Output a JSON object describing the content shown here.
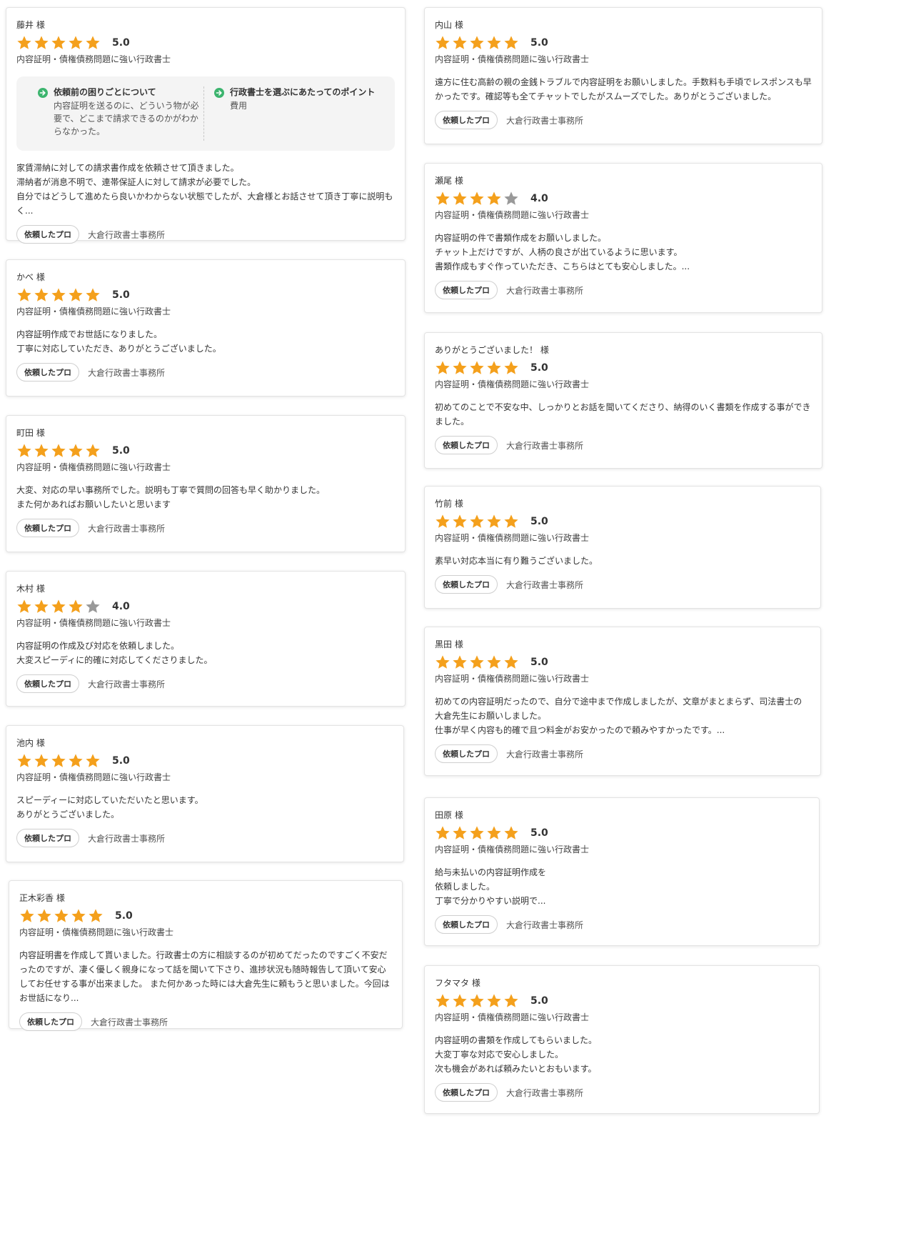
{
  "colors": {
    "star_filled": "#f4a01c",
    "star_empty": "#999999",
    "arrow": "#3cb46e"
  },
  "icons": {
    "star": "star-icon",
    "arrow": "arrow-right-circle-icon"
  },
  "common": {
    "specialty": "内容証明・債権債務問題に強い行政書士",
    "pro_button": "依頼したプロ",
    "office": "大倉行政書士事務所"
  },
  "reviews": [
    {
      "name": "藤井 様",
      "rating": "5.0",
      "stars": 5,
      "detail": {
        "q1_title": "依頼前の困りごとについて",
        "q1_text": "内容証明を送るのに、どういう物が必要で、どこまで請求できるのかがわからなかった。",
        "q2_title": "行政書士を選ぶにあたってのポイント",
        "q2_text": "費用"
      },
      "text": "家賃滞納に対しての請求書作成を依頼させて頂きました。\n滞納者が消息不明で、連帯保証人に対して請求が必要でした。\n自分ではどうして進めたら良いかわからない状態でしたが、大倉様とお話させて頂き丁寧に説明もく..."
    },
    {
      "name": "かべ 様",
      "rating": "5.0",
      "stars": 5,
      "text": "内容証明作成でお世話になりました。\n丁寧に対応していただき、ありがとうございました。"
    },
    {
      "name": "町田 様",
      "rating": "5.0",
      "stars": 5,
      "text": "大変、対応の早い事務所でした。説明も丁寧で質問の回答も早く助かりました。\nまた何かあればお願いしたいと思います"
    },
    {
      "name": "木村 様",
      "rating": "4.0",
      "stars": 4,
      "text": "内容証明の作成及び対応を依頼しました。\n大変スピーディに的確に対応してくださりました。"
    },
    {
      "name": "池内 様",
      "rating": "5.0",
      "stars": 5,
      "text": "スピーディーに対応していただいたと思います。\nありがとうございました。"
    },
    {
      "name": "正木彩香 様",
      "rating": "5.0",
      "stars": 5,
      "text": "内容証明書を作成して貰いました。行政書士の方に相談するのが初めてだったのですごく不安だったのですが、凄く優しく親身になって話を聞いて下さり、進捗状況も随時報告して頂いて安心してお任せする事が出来ました。 また何かあった時には大倉先生に頼もうと思いました。今回はお世話になり..."
    },
    {
      "name": "内山 様",
      "rating": "5.0",
      "stars": 5,
      "text": "遠方に住む高齢の親の金銭トラブルで内容証明をお願いしました。手数料も手頃でレスポンスも早かったです。確認等も全てチャットでしたがスムーズでした。ありがとうございました。"
    },
    {
      "name": "瀬尾 様",
      "rating": "4.0",
      "stars": 4,
      "text": "内容証明の件で書類作成をお願いしました。\nチャット上だけですが、人柄の良さが出ているように思います。\n書類作成もすぐ作っていただき、こちらはとても安心しました。..."
    },
    {
      "name": "ありがとうございました！ 様",
      "rating": "5.0",
      "stars": 5,
      "text": "初めてのことで不安な中、しっかりとお話を聞いてくださり、納得のいく書類を作成する事ができました。"
    },
    {
      "name": "竹前 様",
      "rating": "5.0",
      "stars": 5,
      "text": "素早い対応本当に有り難うございました。"
    },
    {
      "name": "黒田 様",
      "rating": "5.0",
      "stars": 5,
      "text": "初めての内容証明だったので、自分で途中まで作成しましたが、文章がまとまらず、司法書士の大倉先生にお願いしました。\n仕事が早く内容も的確で且つ料金がお安かったので頼みやすかったです。..."
    },
    {
      "name": "田原 様",
      "rating": "5.0",
      "stars": 5,
      "text": "給与未払いの内容証明作成を\n依頼しました。\n丁寧で分かりやすい説明で..."
    },
    {
      "name": "フタマタ 様",
      "rating": "5.0",
      "stars": 5,
      "text": "内容証明の書類を作成してもらいました。\n大変丁寧な対応で安心しました。\n次も機会があれば頼みたいとおもいます。"
    }
  ]
}
